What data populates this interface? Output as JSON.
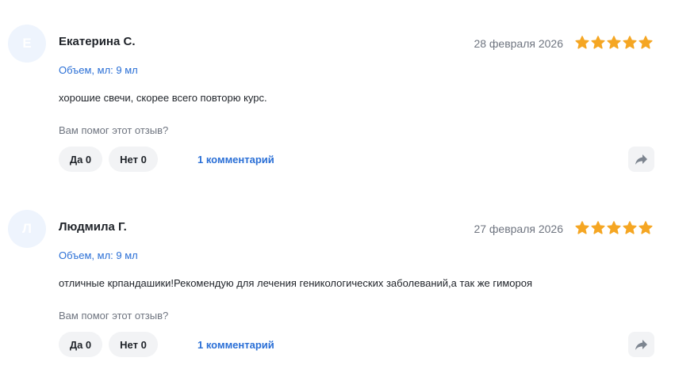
{
  "colors": {
    "accent": "#2a6fd6",
    "star": "#f5a623",
    "muted": "#6f7580",
    "button_bg": "#f2f3f5",
    "avatar_bg": "#eef4fd"
  },
  "reviews": [
    {
      "avatar_letter": "Е",
      "author": "Екатерина С.",
      "date": "28 февраля 2026",
      "rating": 5,
      "variant": "Объем, мл: 9 мл",
      "text": "хорошие свечи, скорее всего повторю курс.",
      "helpful_prompt": "Вам помог этот отзыв?",
      "yes_label": "Да 0",
      "no_label": "Нет 0",
      "comments_label": "1 комментарий",
      "share_icon": "share-arrow-icon"
    },
    {
      "avatar_letter": "Л",
      "author": "Людмила Г.",
      "date": "27 февраля 2026",
      "rating": 5,
      "variant": "Объем, мл: 9 мл",
      "text": "отличные крпандашики!Рекомендую для лечения геникологических заболеваний,а так же гимороя",
      "helpful_prompt": "Вам помог этот отзыв?",
      "yes_label": "Да 0",
      "no_label": "Нет 0",
      "comments_label": "1 комментарий",
      "share_icon": "share-arrow-icon"
    }
  ]
}
